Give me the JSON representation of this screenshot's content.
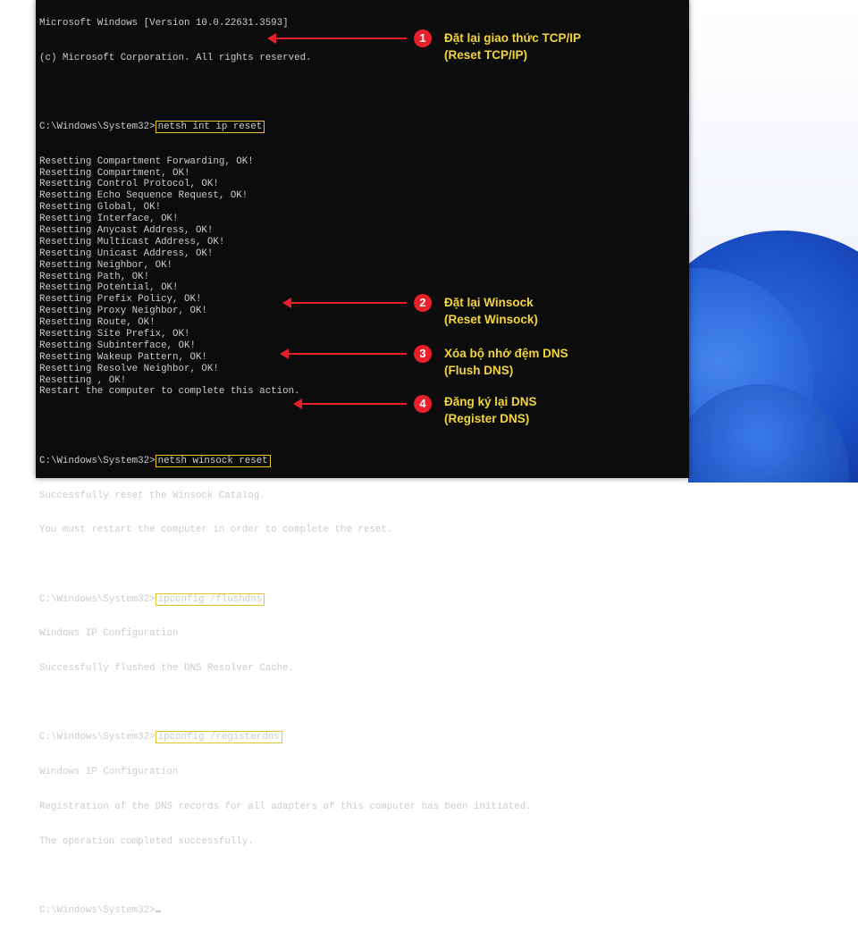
{
  "terminal": {
    "header_line1": "Microsoft Windows [Version 10.0.22631.3593]",
    "header_line2": "(c) Microsoft Corporation. All rights reserved.",
    "prompt": "C:\\Windows\\System32>",
    "cmd1": "netsh int ip reset",
    "reset_lines": [
      "Resetting Compartment Forwarding, OK!",
      "Resetting Compartment, OK!",
      "Resetting Control Protocol, OK!",
      "Resetting Echo Sequence Request, OK!",
      "Resetting Global, OK!",
      "Resetting Interface, OK!",
      "Resetting Anycast Address, OK!",
      "Resetting Multicast Address, OK!",
      "Resetting Unicast Address, OK!",
      "Resetting Neighbor, OK!",
      "Resetting Path, OK!",
      "Resetting Potential, OK!",
      "Resetting Prefix Policy, OK!",
      "Resetting Proxy Neighbor, OK!",
      "Resetting Route, OK!",
      "Resetting Site Prefix, OK!",
      "Resetting Subinterface, OK!",
      "Resetting Wakeup Pattern, OK!",
      "Resetting Resolve Neighbor, OK!",
      "Resetting , OK!",
      "Restart the computer to complete this action."
    ],
    "cmd2": "netsh winsock reset",
    "winsock_line1": "Successfully reset the Winsock Catalog.",
    "winsock_line2": "You must restart the computer in order to complete the reset.",
    "cmd3": "ipconfig /flushdns",
    "flush_line1": "Windows IP Configuration",
    "flush_line2": "Successfully flushed the DNS Resolver Cache.",
    "cmd4": "ipconfig /registerdns",
    "reg_line1": "Windows IP Configuration",
    "reg_line2": "Registration of the DNS records for all adapters of this computer has been initiated.",
    "reg_line3": "The operation completed successfully."
  },
  "annotations": [
    {
      "number": "1",
      "title": "Đặt lại giao thức TCP/IP",
      "subtitle": "(Reset TCP/IP)"
    },
    {
      "number": "2",
      "title": "Đặt lại Winsock",
      "subtitle": "(Reset Winsock)"
    },
    {
      "number": "3",
      "title": "Xóa bộ nhớ đệm DNS",
      "subtitle": "(Flush DNS)"
    },
    {
      "number": "4",
      "title": "Đăng ký lại DNS",
      "subtitle": "(Register DNS)"
    }
  ],
  "colors": {
    "terminal_bg": "#0c0c0c",
    "terminal_text": "#cccccc",
    "command_box": "#e6c235",
    "annotation_red": "#e8202a",
    "annotation_text": "#f2d43a"
  }
}
